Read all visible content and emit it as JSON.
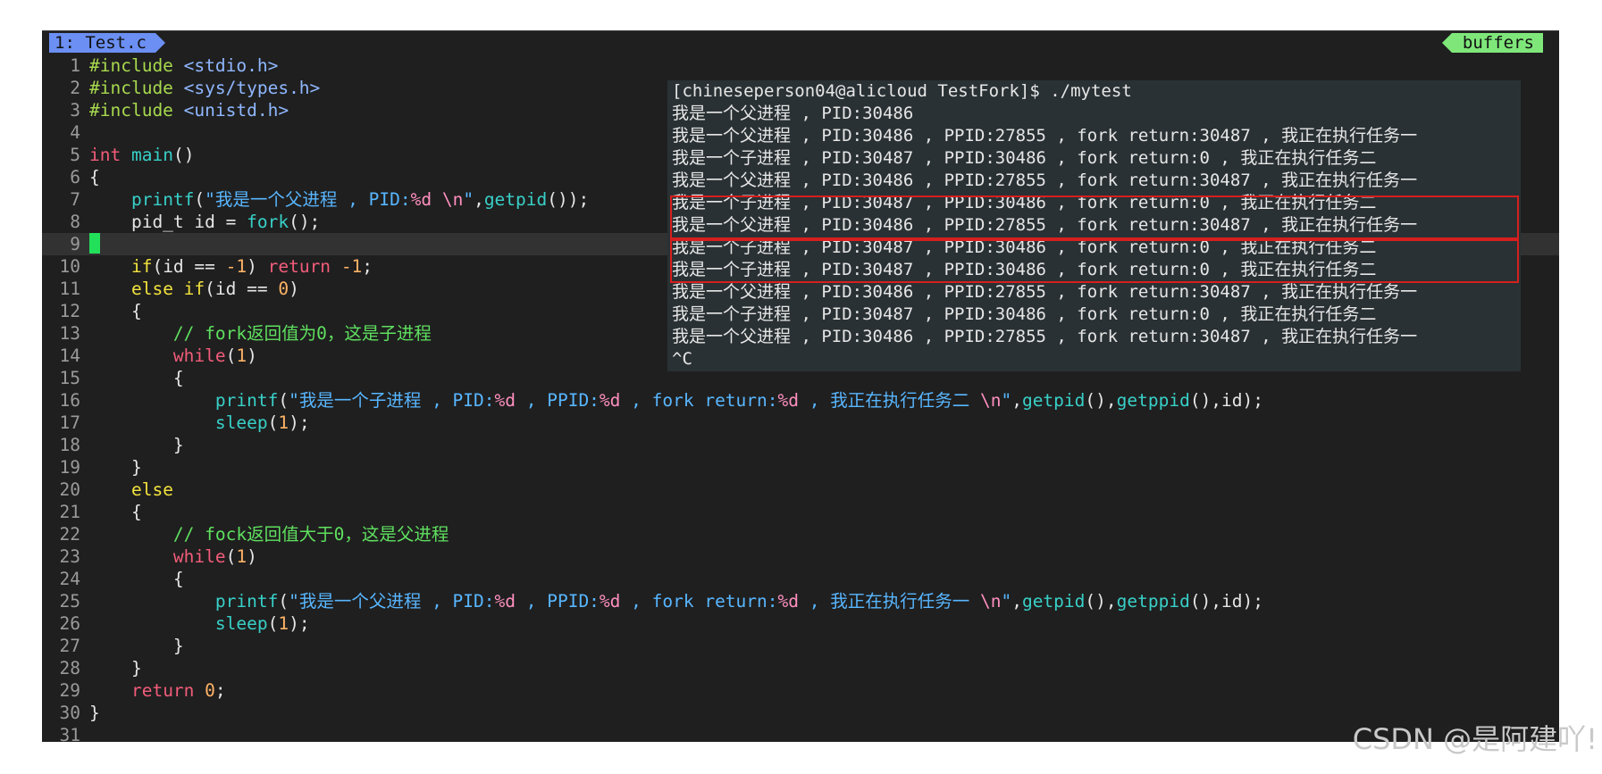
{
  "tabline": {
    "active_tab": "1: Test.c",
    "buffers_label": "buffers"
  },
  "code": [
    {
      "n": "1",
      "segs": [
        {
          "c": "pp",
          "t": "#include"
        },
        {
          "c": "",
          "t": " "
        },
        {
          "c": "inc",
          "t": "<stdio.h>"
        }
      ]
    },
    {
      "n": "2",
      "segs": [
        {
          "c": "pp",
          "t": "#include"
        },
        {
          "c": "",
          "t": " "
        },
        {
          "c": "inc",
          "t": "<sys/types.h>"
        }
      ]
    },
    {
      "n": "3",
      "segs": [
        {
          "c": "pp",
          "t": "#include"
        },
        {
          "c": "",
          "t": " "
        },
        {
          "c": "inc",
          "t": "<unistd.h>"
        }
      ]
    },
    {
      "n": "4",
      "segs": []
    },
    {
      "n": "5",
      "segs": [
        {
          "c": "kw",
          "t": "int"
        },
        {
          "c": "",
          "t": " "
        },
        {
          "c": "fn",
          "t": "main"
        },
        {
          "c": "",
          "t": "()"
        }
      ]
    },
    {
      "n": "6",
      "segs": [
        {
          "c": "",
          "t": "{"
        }
      ]
    },
    {
      "n": "7",
      "segs": [
        {
          "c": "",
          "t": "    "
        },
        {
          "c": "fn",
          "t": "printf"
        },
        {
          "c": "",
          "t": "("
        },
        {
          "c": "str",
          "t": "\"我是一个父进程 , PID:"
        },
        {
          "c": "fmt",
          "t": "%d"
        },
        {
          "c": "str",
          "t": " "
        },
        {
          "c": "fmt",
          "t": "\\n"
        },
        {
          "c": "str",
          "t": "\""
        },
        {
          "c": "",
          "t": ","
        },
        {
          "c": "fn",
          "t": "getpid"
        },
        {
          "c": "",
          "t": "());"
        }
      ]
    },
    {
      "n": "8",
      "segs": [
        {
          "c": "",
          "t": "    pid_t id = "
        },
        {
          "c": "fn",
          "t": "fork"
        },
        {
          "c": "",
          "t": "();"
        }
      ]
    },
    {
      "n": "9",
      "current": true,
      "segs": []
    },
    {
      "n": "10",
      "segs": [
        {
          "c": "",
          "t": "    "
        },
        {
          "c": "ctl",
          "t": "if"
        },
        {
          "c": "",
          "t": "(id == "
        },
        {
          "c": "num",
          "t": "-1"
        },
        {
          "c": "",
          "t": ") "
        },
        {
          "c": "kw",
          "t": "return"
        },
        {
          "c": "",
          "t": " "
        },
        {
          "c": "num",
          "t": "-1"
        },
        {
          "c": "",
          "t": ";"
        }
      ]
    },
    {
      "n": "11",
      "segs": [
        {
          "c": "",
          "t": "    "
        },
        {
          "c": "ctl",
          "t": "else if"
        },
        {
          "c": "",
          "t": "(id == "
        },
        {
          "c": "num",
          "t": "0"
        },
        {
          "c": "",
          "t": ")"
        }
      ]
    },
    {
      "n": "12",
      "segs": [
        {
          "c": "",
          "t": "    {"
        }
      ]
    },
    {
      "n": "13",
      "segs": [
        {
          "c": "",
          "t": "        "
        },
        {
          "c": "cmt",
          "t": "// fork返回值为0，这是子进程"
        }
      ]
    },
    {
      "n": "14",
      "segs": [
        {
          "c": "",
          "t": "        "
        },
        {
          "c": "kw",
          "t": "while"
        },
        {
          "c": "",
          "t": "("
        },
        {
          "c": "num",
          "t": "1"
        },
        {
          "c": "",
          "t": ")"
        }
      ]
    },
    {
      "n": "15",
      "segs": [
        {
          "c": "",
          "t": "        {"
        }
      ]
    },
    {
      "n": "16",
      "segs": [
        {
          "c": "",
          "t": "            "
        },
        {
          "c": "fn",
          "t": "printf"
        },
        {
          "c": "",
          "t": "("
        },
        {
          "c": "str",
          "t": "\"我是一个子进程 , PID:"
        },
        {
          "c": "fmt",
          "t": "%d"
        },
        {
          "c": "str",
          "t": " , PPID:"
        },
        {
          "c": "fmt",
          "t": "%d"
        },
        {
          "c": "str",
          "t": " , fork return:"
        },
        {
          "c": "fmt",
          "t": "%d"
        },
        {
          "c": "str",
          "t": " , 我正在执行任务二 "
        },
        {
          "c": "fmt",
          "t": "\\n"
        },
        {
          "c": "str",
          "t": "\""
        },
        {
          "c": "",
          "t": ","
        },
        {
          "c": "fn",
          "t": "getpid"
        },
        {
          "c": "",
          "t": "(),"
        },
        {
          "c": "fn",
          "t": "getppid"
        },
        {
          "c": "",
          "t": "(),id);"
        }
      ]
    },
    {
      "n": "17",
      "segs": [
        {
          "c": "",
          "t": "            "
        },
        {
          "c": "fn",
          "t": "sleep"
        },
        {
          "c": "",
          "t": "("
        },
        {
          "c": "num",
          "t": "1"
        },
        {
          "c": "",
          "t": ");"
        }
      ]
    },
    {
      "n": "18",
      "segs": [
        {
          "c": "",
          "t": "        }"
        }
      ]
    },
    {
      "n": "19",
      "segs": [
        {
          "c": "",
          "t": "    }"
        }
      ]
    },
    {
      "n": "20",
      "segs": [
        {
          "c": "",
          "t": "    "
        },
        {
          "c": "ctl",
          "t": "else"
        }
      ]
    },
    {
      "n": "21",
      "segs": [
        {
          "c": "",
          "t": "    {"
        }
      ]
    },
    {
      "n": "22",
      "segs": [
        {
          "c": "",
          "t": "        "
        },
        {
          "c": "cmt",
          "t": "// fock返回值大于0，这是父进程"
        }
      ]
    },
    {
      "n": "23",
      "segs": [
        {
          "c": "",
          "t": "        "
        },
        {
          "c": "kw",
          "t": "while"
        },
        {
          "c": "",
          "t": "("
        },
        {
          "c": "num",
          "t": "1"
        },
        {
          "c": "",
          "t": ")"
        }
      ]
    },
    {
      "n": "24",
      "segs": [
        {
          "c": "",
          "t": "        {"
        }
      ]
    },
    {
      "n": "25",
      "segs": [
        {
          "c": "",
          "t": "            "
        },
        {
          "c": "fn",
          "t": "printf"
        },
        {
          "c": "",
          "t": "("
        },
        {
          "c": "str",
          "t": "\"我是一个父进程 , PID:"
        },
        {
          "c": "fmt",
          "t": "%d"
        },
        {
          "c": "str",
          "t": " , PPID:"
        },
        {
          "c": "fmt",
          "t": "%d"
        },
        {
          "c": "str",
          "t": " , fork return:"
        },
        {
          "c": "fmt",
          "t": "%d"
        },
        {
          "c": "str",
          "t": " , 我正在执行任务一 "
        },
        {
          "c": "fmt",
          "t": "\\n"
        },
        {
          "c": "str",
          "t": "\""
        },
        {
          "c": "",
          "t": ","
        },
        {
          "c": "fn",
          "t": "getpid"
        },
        {
          "c": "",
          "t": "(),"
        },
        {
          "c": "fn",
          "t": "getppid"
        },
        {
          "c": "",
          "t": "(),id);"
        }
      ]
    },
    {
      "n": "26",
      "segs": [
        {
          "c": "",
          "t": "            "
        },
        {
          "c": "fn",
          "t": "sleep"
        },
        {
          "c": "",
          "t": "("
        },
        {
          "c": "num",
          "t": "1"
        },
        {
          "c": "",
          "t": ");"
        }
      ]
    },
    {
      "n": "27",
      "segs": [
        {
          "c": "",
          "t": "        }"
        }
      ]
    },
    {
      "n": "28",
      "segs": [
        {
          "c": "",
          "t": "    }"
        }
      ]
    },
    {
      "n": "29",
      "segs": [
        {
          "c": "",
          "t": "    "
        },
        {
          "c": "kw",
          "t": "return"
        },
        {
          "c": "",
          "t": " "
        },
        {
          "c": "num",
          "t": "0"
        },
        {
          "c": "",
          "t": ";"
        }
      ]
    },
    {
      "n": "30",
      "segs": [
        {
          "c": "",
          "t": "}"
        }
      ]
    },
    {
      "n": "31",
      "segs": []
    }
  ],
  "terminal": {
    "lines": [
      "[chineseperson04@alicloud TestFork]$ ./mytest",
      "我是一个父进程 , PID:30486",
      "我是一个父进程 , PID:30486 , PPID:27855 , fork return:30487 , 我正在执行任务一",
      "我是一个子进程 , PID:30487 , PPID:30486 , fork return:0 , 我正在执行任务二",
      "我是一个父进程 , PID:30486 , PPID:27855 , fork return:30487 , 我正在执行任务一",
      "我是一个子进程 , PID:30487 , PPID:30486 , fork return:0 , 我正在执行任务二",
      "我是一个父进程 , PID:30486 , PPID:27855 , fork return:30487 , 我正在执行任务一",
      "我是一个子进程 , PID:30487 , PPID:30486 , fork return:0 , 我正在执行任务二",
      "我是一个子进程 , PID:30487 , PPID:30486 , fork return:0 , 我正在执行任务二",
      "我是一个父进程 , PID:30486 , PPID:27855 , fork return:30487 , 我正在执行任务一",
      "我是一个子进程 , PID:30487 , PPID:30486 , fork return:0 , 我正在执行任务二",
      "我是一个父进程 , PID:30486 , PPID:27855 , fork return:30487 , 我正在执行任务一",
      "^C"
    ],
    "highlight_color": "#d61f1f"
  },
  "watermark": "CSDN @是阿建吖!",
  "colors": {
    "editor_bg": "#1f1f1f",
    "terminal_bg": "#2a3134",
    "tab_active": "#6b8ff2",
    "buffers_tag": "#7fe77a",
    "cursor": "#22e05a"
  }
}
